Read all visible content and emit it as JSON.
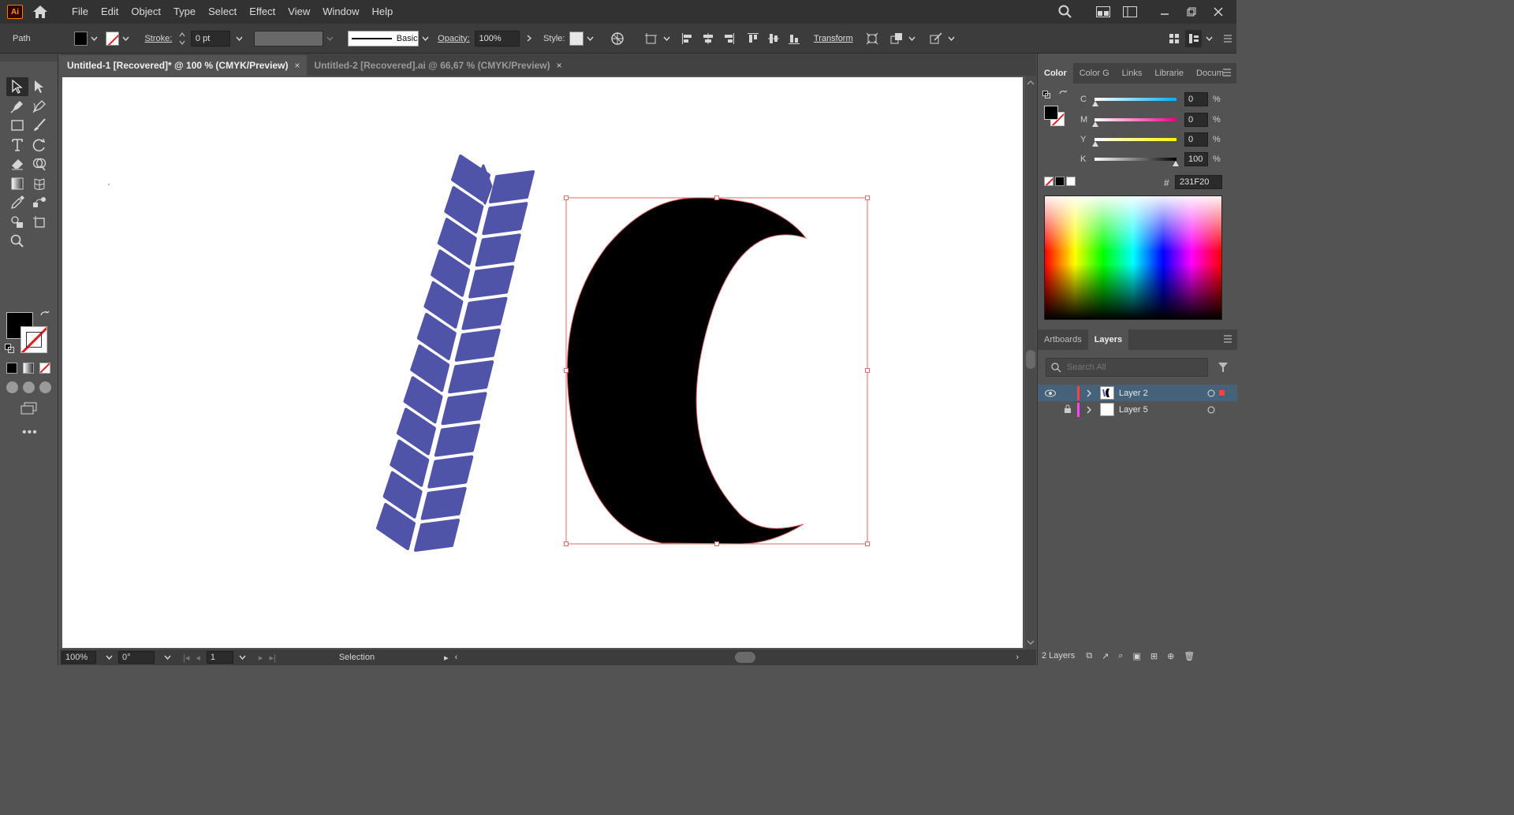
{
  "app": {
    "logo": "Ai",
    "menu": [
      "File",
      "Edit",
      "Object",
      "Type",
      "Select",
      "Effect",
      "View",
      "Window",
      "Help"
    ]
  },
  "control": {
    "selection_type": "Path",
    "stroke_label": "Stroke:",
    "stroke_value": "0 pt",
    "brush_label": "Basic",
    "opacity_label": "Opacity:",
    "opacity_value": "100%",
    "style_label": "Style:",
    "transform_label": "Transform"
  },
  "tabs": [
    {
      "title": "Untitled-1 [Recovered]* @ 100 % (CMYK/Preview)",
      "close": "×"
    },
    {
      "title": "Untitled-2 [Recovered].ai @ 66,67 % (CMYK/Preview)",
      "close": "×"
    }
  ],
  "status": {
    "zoom": "100%",
    "rotation": "0°",
    "artboard_number": "1",
    "tool": "Selection"
  },
  "color_panel": {
    "tabs": [
      "Color",
      "Color G",
      "Links",
      "Librarie",
      "Docum"
    ],
    "channels": [
      {
        "label": "C",
        "value": "0",
        "unit": "%"
      },
      {
        "label": "M",
        "value": "0",
        "unit": "%"
      },
      {
        "label": "Y",
        "value": "0",
        "unit": "%"
      },
      {
        "label": "K",
        "value": "100",
        "unit": "%"
      }
    ],
    "hex_label": "#",
    "hex_value": "231F20"
  },
  "layers_panel": {
    "tabs": [
      "Artboards",
      "Layers"
    ],
    "search_placeholder": "Search All",
    "layers": [
      {
        "name": "Layer 2",
        "color": "#ff4040"
      },
      {
        "name": "Layer 5",
        "color": "#ff40ff"
      }
    ],
    "count": "2 Layers"
  },
  "colors": {
    "leaf_fill": "#5054a8",
    "tire_fill": "#000000",
    "selection": "#e06a6a"
  }
}
